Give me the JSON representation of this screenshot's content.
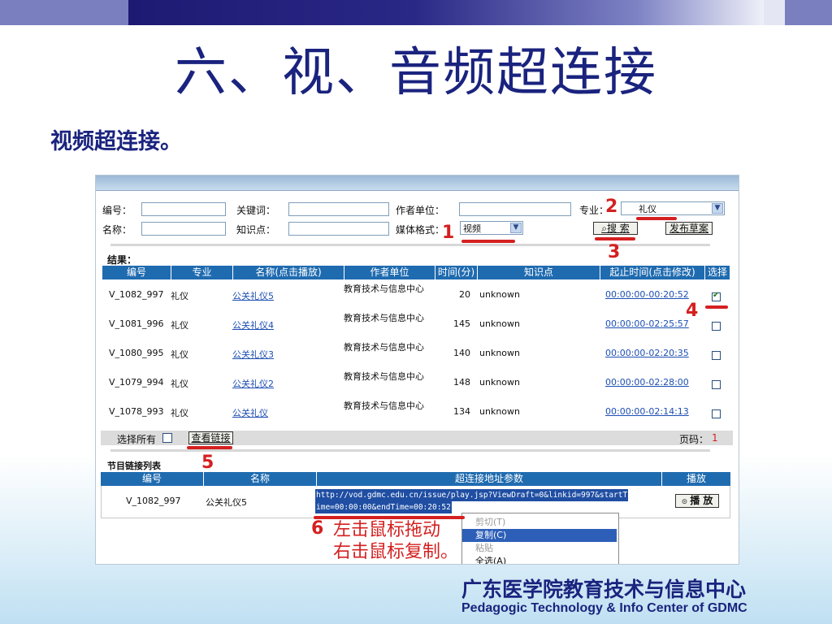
{
  "slide": {
    "title": "六、视、音频超连接",
    "subtitle": "视频超连接。",
    "brand_cn": "广东医学院教育技术与信息中心",
    "brand_en": "Pedagogic Technology & Info Center of GDMC"
  },
  "search_form": {
    "id_label": "编号：",
    "keyword_label": "关键词：",
    "author_unit_label": "作者单位：",
    "major_label": "专业：",
    "major_value": "礼仪",
    "name_label": "名称：",
    "knowledge_label": "知识点：",
    "media_label": "媒体格式：",
    "media_value": "视频",
    "search_button": "搜 索",
    "publish_button": "发布草案"
  },
  "results": {
    "label": "结果：",
    "columns": [
      "编号",
      "专业",
      "名称(点击播放)",
      "作者单位",
      "时间(分)",
      "知识点",
      "起止时间(点击修改)",
      "选择"
    ],
    "rows": [
      {
        "id": "V_1082_997",
        "major": "礼仪",
        "name": "公关礼仪5",
        "unit": "教育技术与信息中心",
        "time": "20",
        "kp": "unknown",
        "range": "00:00:00-00:20:52",
        "checked": true
      },
      {
        "id": "V_1081_996",
        "major": "礼仪",
        "name": "公关礼仪4",
        "unit": "教育技术与信息中心",
        "time": "145",
        "kp": "unknown",
        "range": "00:00:00-02:25:57",
        "checked": false
      },
      {
        "id": "V_1080_995",
        "major": "礼仪",
        "name": "公关礼仪3",
        "unit": "教育技术与信息中心",
        "time": "140",
        "kp": "unknown",
        "range": "00:00:00-02:20:35",
        "checked": false
      },
      {
        "id": "V_1079_994",
        "major": "礼仪",
        "name": "公关礼仪2",
        "unit": "教育技术与信息中心",
        "time": "148",
        "kp": "unknown",
        "range": "00:00:00-02:28:00",
        "checked": false
      },
      {
        "id": "V_1078_993",
        "major": "礼仪",
        "name": "公关礼仪",
        "unit": "教育技术与信息中心",
        "time": "134",
        "kp": "unknown",
        "range": "00:00:00-02:14:13",
        "checked": false
      }
    ],
    "select_all_label": "选择所有",
    "view_link_button": "查看链接",
    "page_label": "页码：",
    "page_value": "1"
  },
  "link_list": {
    "title": "节目链接列表",
    "columns": [
      "编号",
      "名称",
      "超连接地址参数",
      "播放"
    ],
    "row": {
      "id": "V_1082_997",
      "name": "公关礼仪5",
      "url_line1": "http://vod.gdmc.edu.cn/issue/play.jsp?ViewDraft=0&linkid=997&startT",
      "url_line2": "ime=00:00:00&endTime=00:20:52",
      "play_button": "播 放"
    }
  },
  "context_menu": {
    "items": [
      "剪切(T)",
      "复制(C)",
      "粘贴",
      "全选(A)"
    ],
    "highlighted": "复制(C)"
  },
  "annotations": {
    "markers": [
      "1",
      "2",
      "3",
      "4",
      "5",
      "6"
    ],
    "instruction_line1": "左击鼠标拖动",
    "instruction_line2": "右击鼠标复制。"
  },
  "colors": {
    "header_blue": "#1f6bb0",
    "annotation_red": "#d42020",
    "title_navy": "#1a237e"
  }
}
